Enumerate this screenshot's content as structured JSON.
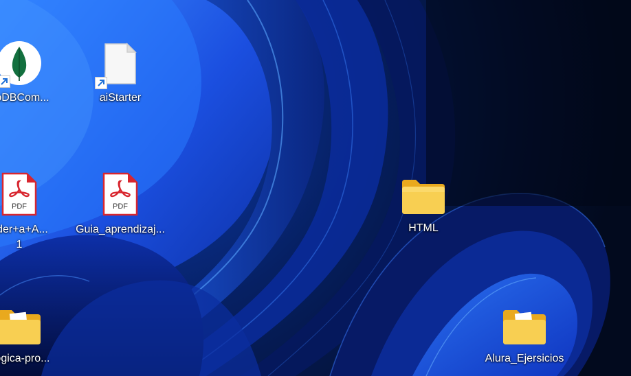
{
  "desktop": {
    "icons": [
      {
        "label": "goDBCom...",
        "icon": "mongodb-leaf-icon",
        "shortcut": true
      },
      {
        "label": "aiStarter",
        "icon": "blank-file-icon",
        "shortcut": true
      },
      {
        "label": "nder+a+A...",
        "label_line2": "1",
        "icon": "pdf-file-icon",
        "badge": "PDF"
      },
      {
        "label": "Guia_aprendizaj...",
        "icon": "pdf-file-icon",
        "badge": "PDF"
      },
      {
        "label": "HTML",
        "icon": "folder-icon"
      },
      {
        "label": "-logica-pro...",
        "icon": "folder-icon"
      },
      {
        "label": "Alura_Ejersicios",
        "icon": "folder-icon"
      }
    ]
  },
  "colors": {
    "pdf_red": "#d8262f",
    "folder_yellow": "#f6c84a",
    "mongodb_green": "#13703f",
    "shortcut_blue": "#1e6fd6"
  }
}
